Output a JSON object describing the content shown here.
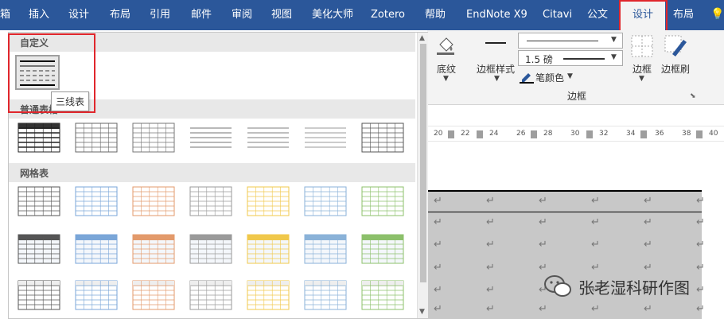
{
  "tabs": [
    "箱",
    "插入",
    "设计",
    "布局",
    "引用",
    "邮件",
    "审阅",
    "视图",
    "美化大师",
    "Zotero",
    "帮助",
    "EndNote X9",
    "Citavi",
    "公文",
    "设计",
    "布局"
  ],
  "active_tab_index": 14,
  "ribbon": {
    "shading_label": "底纹",
    "border_styles_label": "边框样式",
    "line_weight": "1.5 磅",
    "pen_color_label": "笔颜色",
    "borders_label": "边框",
    "border_painter_label": "边框刷",
    "group_label": "边框"
  },
  "ruler": [
    "20",
    "22",
    "24",
    "26",
    "28",
    "30",
    "32",
    "34",
    "36",
    "38",
    "40"
  ],
  "gallery": {
    "custom_title": "自定义",
    "normal_title": "普通表格",
    "grid_title": "网格表",
    "tooltip": "三线表",
    "grid_accents": [
      "#555555",
      "#7aa6d8",
      "#e39a6b",
      "#9a9a9a",
      "#f0c84b",
      "#8ab2d8",
      "#8cc06b"
    ]
  },
  "doc": {
    "enter_mark": "↵"
  },
  "watermark": "张老湿科研作图"
}
